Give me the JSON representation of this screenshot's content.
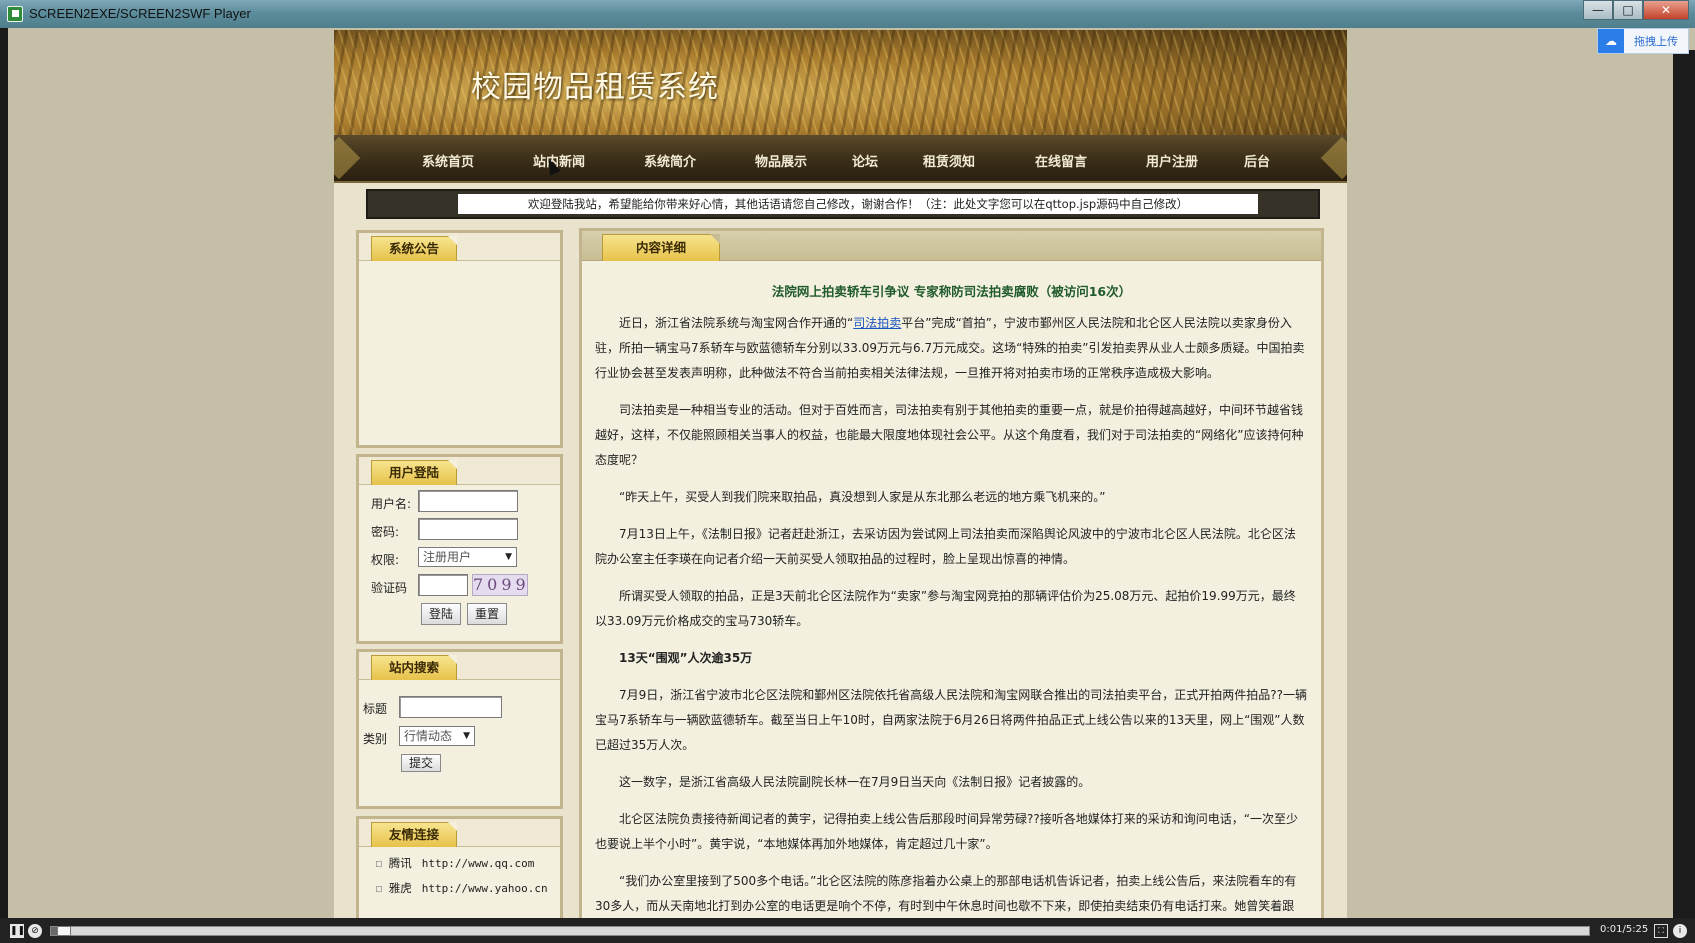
{
  "window": {
    "title": "SCREEN2EXE/SCREEN2SWF Player",
    "minimize": "—",
    "maximize": "□",
    "close": "✕"
  },
  "upload_widget": {
    "label": "拖拽上传"
  },
  "site": {
    "title": "校园物品租赁系统",
    "nav": [
      "系统首页",
      "站内新闻",
      "系统简介",
      "物品展示",
      "论坛",
      "租赁须知",
      "在线留言",
      "用户注册",
      "后台"
    ],
    "marquee": "欢迎登陆我站，希望能给你带来好心情，其他话语请您自己修改，谢谢合作！（注：此处文字您可以在qttop.jsp源码中自己修改）"
  },
  "sidebar": {
    "announcement": {
      "title": "系统公告"
    },
    "login": {
      "title": "用户登陆",
      "username_label": "用户名:",
      "password_label": "密码:",
      "role_label": "权限:",
      "role_value": "注册用户",
      "captcha_label": "验证码",
      "captcha_value": "7099",
      "login_button": "登陆",
      "reset_button": "重置"
    },
    "search": {
      "title": "站内搜索",
      "title_label": "标题",
      "category_label": "类别",
      "category_value": "行情动态",
      "submit_button": "提交"
    },
    "links": {
      "title": "友情连接",
      "items": [
        {
          "name": "腾讯",
          "url": "http://www.qq.com"
        },
        {
          "name": "雅虎",
          "url": "http://www.yahoo.cn"
        }
      ]
    }
  },
  "content": {
    "tab": "内容详细",
    "article_title": "法院网上拍卖轿车引争议 专家称防司法拍卖腐败（被访问16次）",
    "p1_pre": "近日，浙江省法院系统与淘宝网合作开通的“",
    "p1_link": "司法拍卖",
    "p1_post": "平台”完成“首拍”，宁波市鄞州区人民法院和北仑区人民法院以卖家身份入驻，所拍一辆宝马7系轿车与欧蓝德轿车分别以33.09万元与6.7万元成交。这场“特殊的拍卖”引发拍卖界从业人士颇多质疑。中国拍卖行业协会甚至发表声明称，此种做法不符合当前拍卖相关法律法规，一旦推开将对拍卖市场的正常秩序造成极大影响。",
    "p2": "司法拍卖是一种相当专业的活动。但对于百姓而言，司法拍卖有别于其他拍卖的重要一点，就是价拍得越高越好，中间环节越省钱越好，这样，不仅能照顾相关当事人的权益，也能最大限度地体现社会公平。从这个角度看，我们对于司法拍卖的“网络化”应该持何种态度呢？",
    "p3": "“昨天上午，买受人到我们院来取拍品，真没想到人家是从东北那么老远的地方乘飞机来的。”",
    "p4": "7月13日上午，《法制日报》记者赶赴浙江，去采访因为尝试网上司法拍卖而深陷舆论风波中的宁波市北仑区人民法院。北仑区法院办公室主任李瑛在向记者介绍一天前买受人领取拍品的过程时，脸上呈现出惊喜的神情。",
    "p5": "所谓买受人领取的拍品，正是3天前北仑区法院作为“卖家”参与淘宝网竞拍的那辆评估价为25.08万元、起拍价19.99万元，最终以33.09万元价格成交的宝马730轿车。",
    "p6": "13天“围观”人次逾35万",
    "p7": "7月9日，浙江省宁波市北仑区法院和鄞州区法院依托省高级人民法院和淘宝网联合推出的司法拍卖平台，正式开拍两件拍品??一辆宝马7系轿车与一辆欧蓝德轿车。截至当日上午10时，自两家法院于6月26日将两件拍品正式上线公告以来的13天里，网上“围观”人数已超过35万人次。",
    "p8": "这一数字，是浙江省高级人民法院副院长林一在7月9日当天向《法制日报》记者披露的。",
    "p9": "北仑区法院负责接待新闻记者的黄宇，记得拍卖上线公告后那段时间异常劳碌??接听各地媒体打来的采访和询问电话，“一次至少也要说上半个小时”。黄宇说，“本地媒体再加外地媒体，肯定超过几十家”。",
    "p10": "“我们办公室里接到了500多个电话。”北仑区法院的陈彦指着办公桌上的那部电话机告诉记者，拍卖上线公告后，来法院看车的有30多人，而从天南地北打到办公室的电话更是响个不停，有时到中午休息时间也歇不下来，即使拍卖结束仍有电话打来。她曾笑着跟"
  },
  "player": {
    "time": "0:01/5:25",
    "progress": 0.01
  }
}
